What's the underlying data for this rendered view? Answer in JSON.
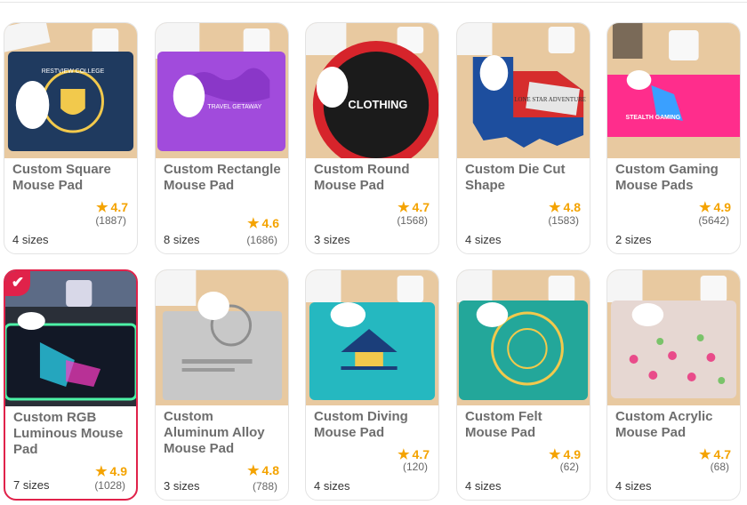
{
  "products": [
    {
      "title": "Custom Square Mouse Pad",
      "sizes": "4 sizes",
      "rating": "4.7",
      "reviews": "(1887)",
      "pad_art": "RESTVIEW COLLEGE",
      "pad_color": "#1f3a5f"
    },
    {
      "title": "Custom Rectangle Mouse Pad",
      "sizes": "8 sizes",
      "rating": "4.6",
      "reviews": "(1686)",
      "pad_art": "TRAVEL GETAWAY",
      "pad_color": "#a14bdc"
    },
    {
      "title": "Custom Round Mouse Pad",
      "sizes": "3 sizes",
      "rating": "4.7",
      "reviews": "(1568)",
      "pad_art": "CLOTHING",
      "pad_color": "#d6242b"
    },
    {
      "title": "Custom Die Cut Shape",
      "sizes": "4 sizes",
      "rating": "4.8",
      "reviews": "(1583)",
      "pad_art": "LONE STAR ADVENTURE",
      "pad_color": "#1d4e9e"
    },
    {
      "title": "Custom Gaming Mouse Pads",
      "sizes": "2 sizes",
      "rating": "4.9",
      "reviews": "(5642)",
      "pad_art": "STEALTH GAMING",
      "pad_color": "#ff2d8c"
    },
    {
      "title": "Custom RGB Luminous Mouse Pad",
      "sizes": "7 sizes",
      "rating": "4.9",
      "reviews": "(1028)",
      "pad_art": "",
      "pad_color": "#121826",
      "selected": true
    },
    {
      "title": "Custom Aluminum Alloy Mouse Pad",
      "sizes": "3 sizes",
      "rating": "4.8",
      "reviews": "(788)",
      "pad_art": "",
      "pad_color": "#c8c8c8"
    },
    {
      "title": "Custom Diving Mouse Pad",
      "sizes": "4 sizes",
      "rating": "4.7",
      "reviews": "(120)",
      "pad_art": "",
      "pad_color": "#25b8c0"
    },
    {
      "title": "Custom Felt Mouse Pad",
      "sizes": "4 sizes",
      "rating": "4.9",
      "reviews": "(62)",
      "pad_art": "",
      "pad_color": "#23a79a"
    },
    {
      "title": "Custom Acrylic Mouse Pad",
      "sizes": "4 sizes",
      "rating": "4.7",
      "reviews": "(68)",
      "pad_art": "",
      "pad_color": "#e6d7d2"
    }
  ],
  "icons": {
    "rating": "star-icon",
    "selected": "checkmark-icon"
  },
  "colors": {
    "accent": "#e0224a",
    "star": "#f4a300"
  }
}
